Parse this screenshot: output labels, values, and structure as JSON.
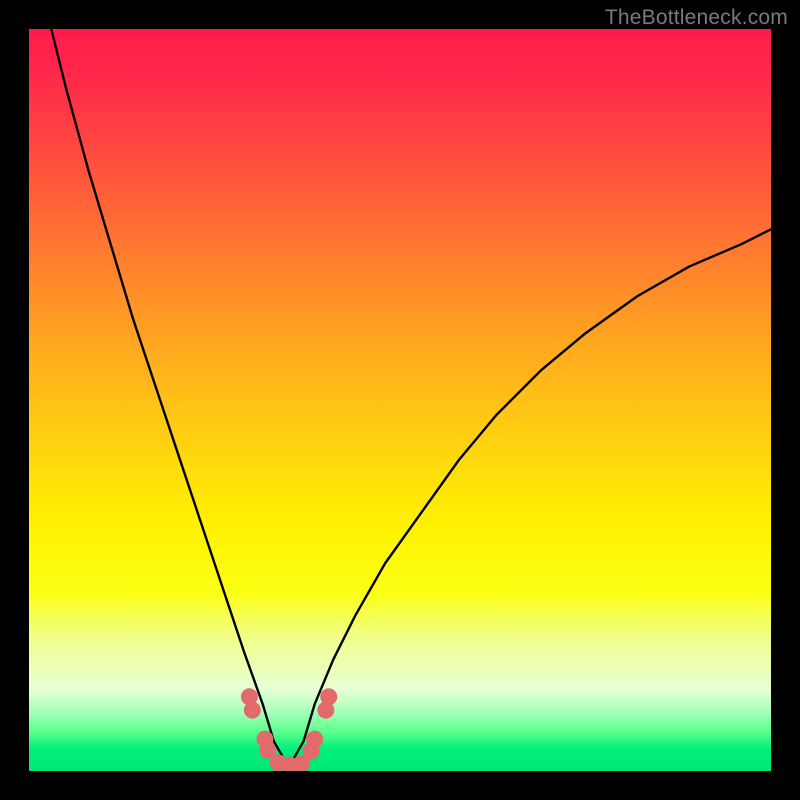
{
  "watermark": "TheBottleneck.com",
  "colors": {
    "frame": "#000000",
    "gradient_top": "#ff1a4d",
    "gradient_bottom": "#00e676",
    "curve": "#000000",
    "markers": "#e26a6a"
  },
  "chart_data": {
    "type": "line",
    "title": "",
    "xlabel": "",
    "ylabel": "",
    "xlim": [
      0,
      100
    ],
    "ylim": [
      0,
      100
    ],
    "note": "No axis tick labels are shown in the image; x/y values are read as percent of plot width/height with (0,0) at bottom-left. The curve depicts a bottleneck V-curve reaching ~0 at x≈35.",
    "series": [
      {
        "name": "curve",
        "x": [
          3,
          5,
          8,
          11,
          14,
          17,
          20,
          23,
          26,
          29,
          31.5,
          33,
          35,
          37,
          38.5,
          41,
          44,
          48,
          53,
          58,
          63,
          69,
          75,
          82,
          89,
          96,
          100
        ],
        "y": [
          100,
          92,
          81,
          71,
          61,
          52,
          43,
          34,
          25,
          16,
          9,
          4,
          0.5,
          4,
          9,
          15,
          21,
          28,
          35,
          42,
          48,
          54,
          59,
          64,
          68,
          71,
          73
        ]
      }
    ],
    "markers": [
      {
        "x": 29.7,
        "y": 10.0
      },
      {
        "x": 30.1,
        "y": 8.2
      },
      {
        "x": 31.8,
        "y": 4.3
      },
      {
        "x": 32.2,
        "y": 2.8
      },
      {
        "x": 33.6,
        "y": 1.1
      },
      {
        "x": 35.1,
        "y": 0.8
      },
      {
        "x": 36.7,
        "y": 1.0
      },
      {
        "x": 38.0,
        "y": 2.7
      },
      {
        "x": 38.5,
        "y": 4.3
      },
      {
        "x": 40.0,
        "y": 8.2
      },
      {
        "x": 40.4,
        "y": 10.0
      }
    ]
  }
}
